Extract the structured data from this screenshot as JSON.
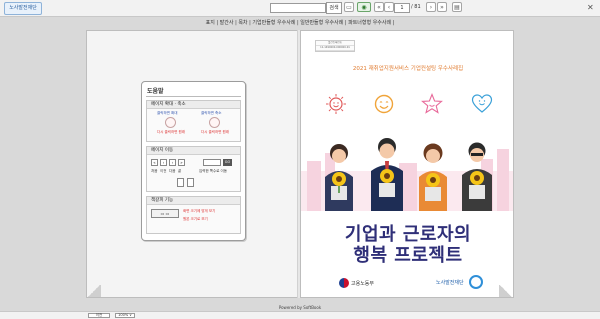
{
  "window": {
    "logo_text": "노사발전재단",
    "search_button": "검색",
    "page_current": "1",
    "page_total": "/ 81",
    "close_symbol": "✕"
  },
  "breadcrumb": "표지 | 발간사 | 목차 | 기업만들형 우수사례 | 일반만들형 우수사례 | 파트너형형 우수사례 |",
  "help": {
    "title": "도움말",
    "zoom_title": "페이지 확대 · 축소",
    "zoom_in": "클릭하면 확대",
    "zoom_out": "클릭하면 축소",
    "zoom_note": "다시 클릭하면 원래",
    "nav_title": "페이지 이동",
    "nav_labels": [
      "처음",
      "이전",
      "다음",
      "끝"
    ],
    "nav_note": "입력한 쪽수로 이동",
    "go_label": "GO",
    "fit_title": "책갈피 기능",
    "fit_note_1": "화면 크기에 맞게 보기",
    "fit_note_2": "원본 크기로 보기"
  },
  "cover": {
    "stamp_rows": [
      "발간등록번호",
      "11-1490000-000000-01"
    ],
    "report_title": "2021 재취업지원서비스 기업컨설팅 우수사례집",
    "main_title_line1": "기업과 근로자의",
    "main_title_line2": "행복 프로젝트",
    "ministry_name": "고용노동부",
    "foundation_name": "노사발전재단"
  },
  "footer": {
    "powered": "Powered by SoftBook",
    "zoom_value": "100% ∨",
    "left_button": "이전"
  },
  "colors": {
    "accent_orange": "#e07a2e",
    "title_navy": "#2f2f78",
    "emoji_red": "#e05a5a",
    "emoji_orange": "#f0a43a",
    "emoji_pink": "#e86a9a",
    "emoji_blue": "#3aa0d8"
  }
}
